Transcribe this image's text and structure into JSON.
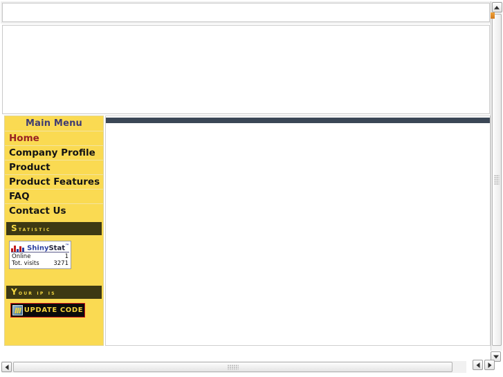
{
  "window": {
    "title": ""
  },
  "sidebar": {
    "menu_title": "Main Menu",
    "items": [
      {
        "label": "Home",
        "active": true
      },
      {
        "label": "Company Profile",
        "active": false
      },
      {
        "label": "Product",
        "active": false
      },
      {
        "label": "Product Features",
        "active": false
      },
      {
        "label": "FAQ",
        "active": false
      },
      {
        "label": "Contact Us",
        "active": false
      }
    ],
    "sections": {
      "statistic": {
        "first_letter": "S",
        "rest": "tatistic",
        "full": "Statistic"
      },
      "your_ip": {
        "full": "Your IP is"
      }
    },
    "shinystat": {
      "brand_first": "Shiny",
      "brand_second": "Stat",
      "trademark": "™",
      "rows": [
        {
          "label": "Online",
          "value": "1"
        },
        {
          "label": "Tot. visits",
          "value": "3271"
        }
      ]
    },
    "update_button": {
      "label": "UPDATE CODE"
    }
  },
  "colors": {
    "sidebar_yellow": "#fada52",
    "section_dark": "#3d3913",
    "section_text": "#f5d941",
    "menu_title_text": "#3f3c72",
    "active_item_text": "#992222",
    "content_topbar": "#3b4756",
    "update_border": "#d01717",
    "update_text": "#f5d33b",
    "shinystat_blue": "#2b3fa0",
    "shinystat_red": "#c21b1b"
  },
  "scrollbars": {
    "vertical": {
      "up": "scroll-up",
      "down": "scroll-down"
    },
    "horizontal": {
      "left": "scroll-left",
      "right": "scroll-right"
    }
  }
}
